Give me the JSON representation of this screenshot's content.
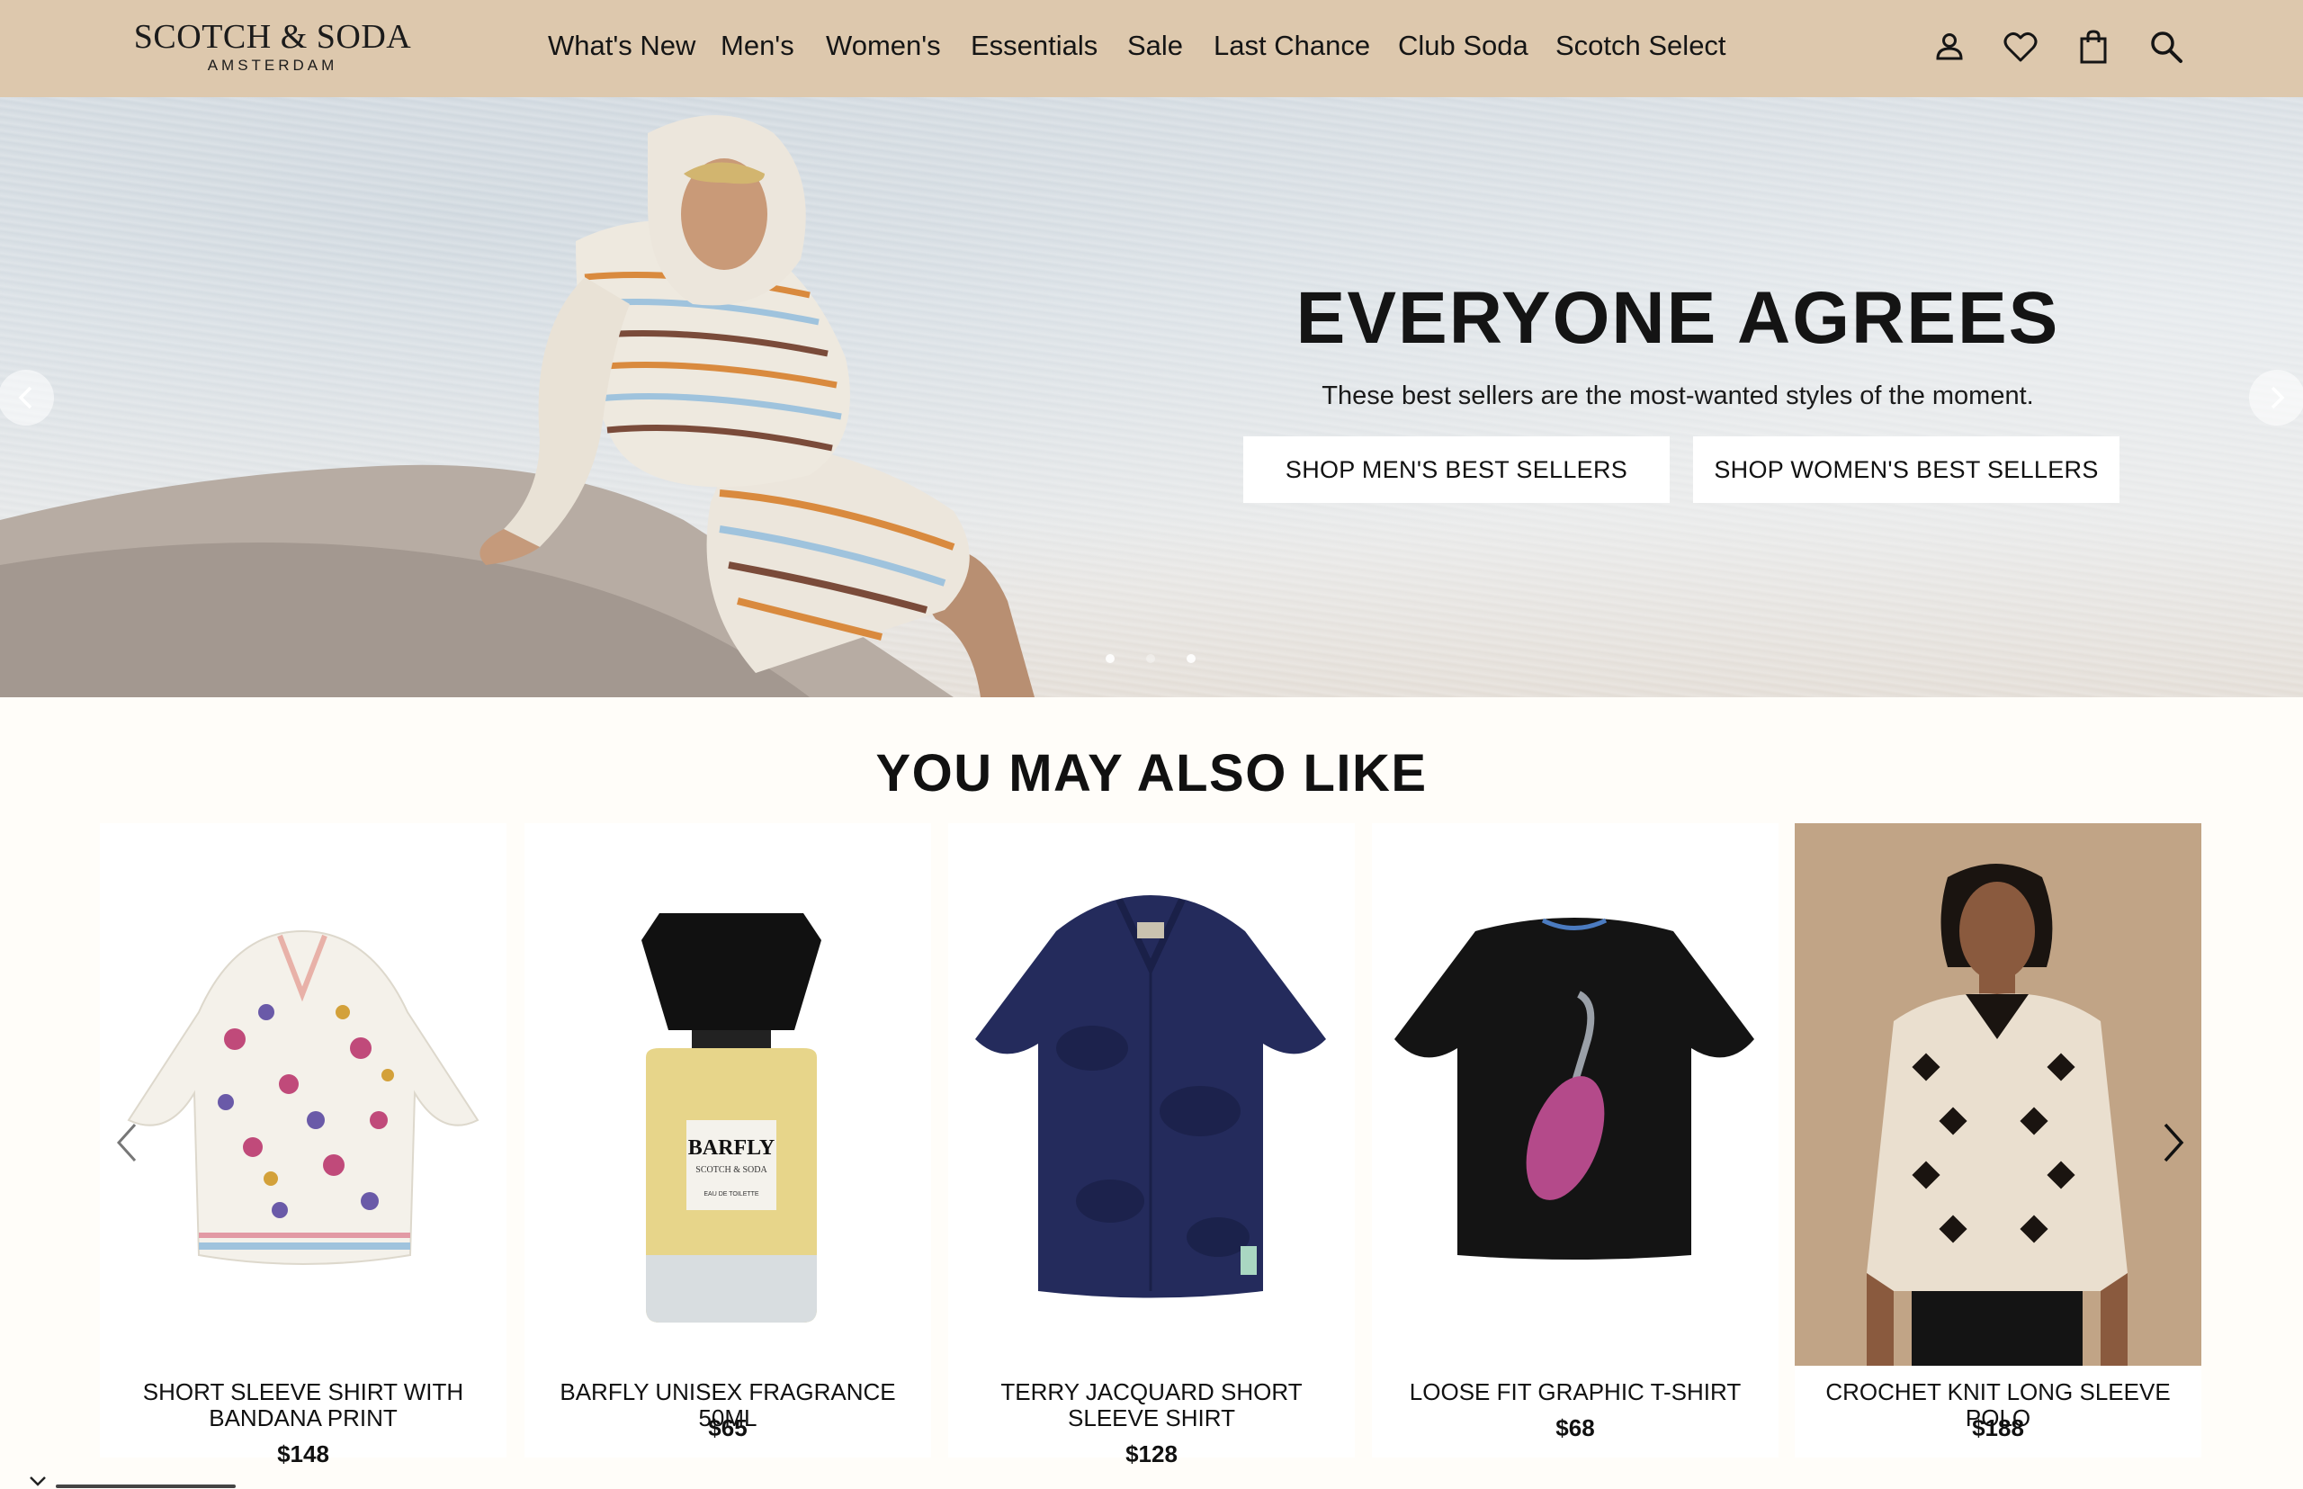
{
  "brand": {
    "name": "SCOTCH & SODA",
    "city": "AMSTERDAM"
  },
  "nav": {
    "items": [
      "What's New",
      "Men's",
      "Women's",
      "Essentials",
      "Sale",
      "Last Chance",
      "Club Soda",
      "Scotch Select"
    ]
  },
  "header_icons": [
    "account-icon",
    "wishlist-heart-icon",
    "shopping-bag-icon",
    "search-icon"
  ],
  "hero": {
    "title": "EVERYONE AGREES",
    "subtitle": "These best sellers are the most-wanted styles of the moment.",
    "buttons": [
      "SHOP MEN'S BEST SELLERS",
      "SHOP WOMEN'S BEST SELLERS"
    ],
    "slide_count": 3,
    "active_slide": 1
  },
  "recommendations": {
    "title": "YOU MAY ALSO LIKE",
    "products": [
      {
        "name": "SHORT SLEEVE SHIRT WITH BANDANA PRINT",
        "price": "$148",
        "image": "printed-shirt"
      },
      {
        "name": "BARFLY UNISEX FRAGRANCE 50ML",
        "price": "$65",
        "image": "fragrance-bottle",
        "label_title": "BARFLY",
        "label_brand": "SCOTCH & SODA",
        "label_type": "EAU DE TOILETTE"
      },
      {
        "name": "TERRY JACQUARD SHORT SLEEVE SHIRT",
        "price": "$128",
        "image": "navy-shirt"
      },
      {
        "name": "LOOSE FIT GRAPHIC T-SHIRT",
        "price": "$68",
        "image": "black-tshirt"
      },
      {
        "name": "CROCHET KNIT LONG SLEEVE POLO",
        "price": "$188",
        "image": "model-crochet-polo"
      }
    ]
  },
  "colors": {
    "header_bg": "#ddc8ad",
    "page_bg": "#fffdf9",
    "text": "#111111",
    "button_bg": "#ffffff"
  }
}
